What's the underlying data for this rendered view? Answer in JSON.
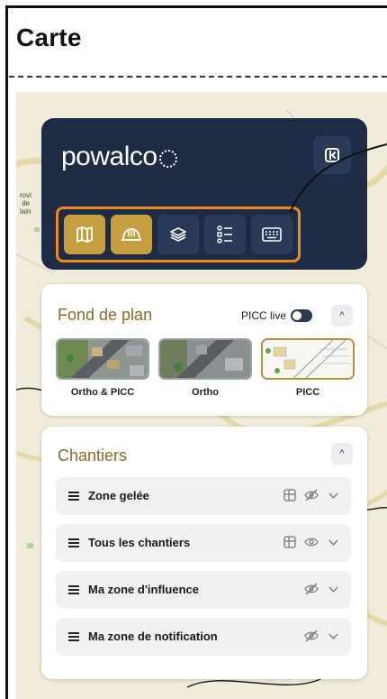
{
  "page": {
    "title": "Carte"
  },
  "header": {
    "logo_text": "powalco"
  },
  "toolbar": {
    "tools": [
      {
        "icon": "map-icon",
        "active": true
      },
      {
        "icon": "helmet-icon",
        "active": true
      },
      {
        "icon": "layers-icon",
        "active": false
      },
      {
        "icon": "list-icon",
        "active": false
      },
      {
        "icon": "keyboard-icon",
        "active": false
      }
    ]
  },
  "map": {
    "place_label": "rovi\nde\nlain"
  },
  "fond_de_plan": {
    "title": "Fond de plan",
    "picc_live_label": "PICC live",
    "picc_live_enabled": false,
    "options": [
      {
        "label": "Ortho & PICC",
        "selected": false
      },
      {
        "label": "Ortho",
        "selected": false
      },
      {
        "label": "PICC",
        "selected": true
      }
    ]
  },
  "chantiers": {
    "title": "Chantiers",
    "rows": [
      {
        "label": "Zone gelée",
        "icons": [
          "table-icon",
          "eye-off-icon"
        ]
      },
      {
        "label": "Tous les chantiers",
        "icons": [
          "table-icon",
          "eye-icon"
        ]
      },
      {
        "label": "Ma zone d'influence",
        "icons": [
          "eye-off-icon"
        ]
      },
      {
        "label": "Ma zone de notification",
        "icons": [
          "eye-off-icon"
        ]
      }
    ]
  },
  "colors": {
    "panel": "#1d2b45",
    "active_tool": "#c59f3f",
    "highlight": "#ee8a1c",
    "card_title": "#8a6b26"
  }
}
